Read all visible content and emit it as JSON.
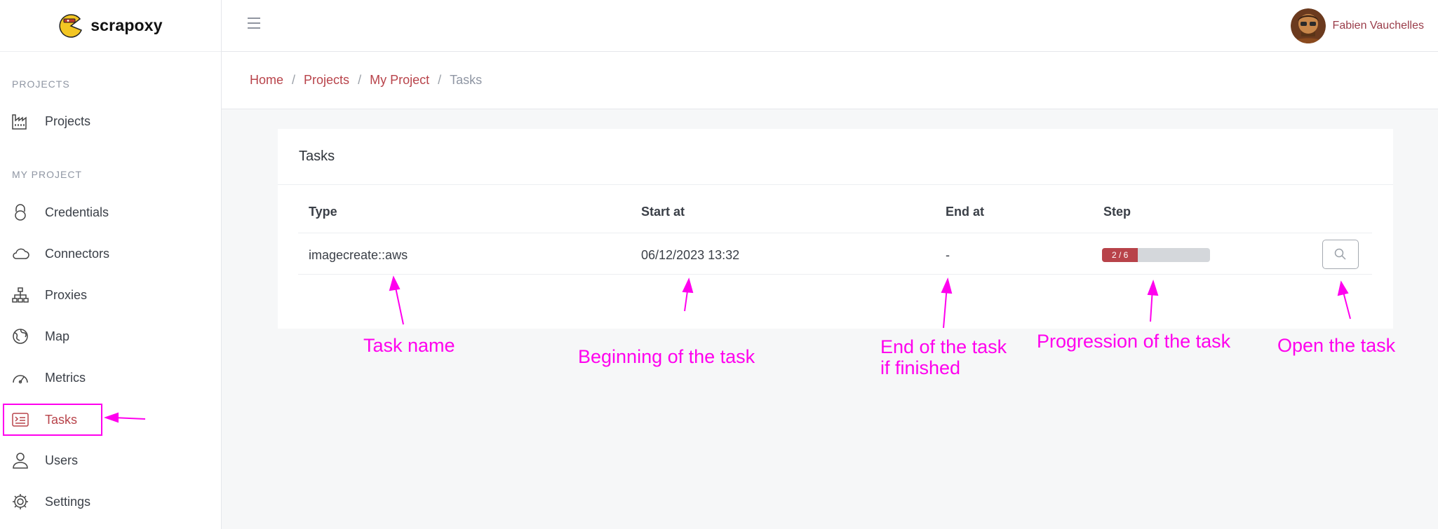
{
  "brand": {
    "name": "scrapoxy"
  },
  "user": {
    "name": "Fabien Vauchelles"
  },
  "sidebar": {
    "section_projects": "PROJECTS",
    "section_my_project": "MY PROJECT",
    "items": [
      {
        "label": "Projects",
        "icon": "factory-icon"
      },
      {
        "label": "Credentials",
        "icon": "lock-icon"
      },
      {
        "label": "Connectors",
        "icon": "cloud-icon"
      },
      {
        "label": "Proxies",
        "icon": "sitemap-icon"
      },
      {
        "label": "Map",
        "icon": "globe-icon"
      },
      {
        "label": "Metrics",
        "icon": "gauge-icon"
      },
      {
        "label": "Tasks",
        "icon": "terminal-icon",
        "active": true
      },
      {
        "label": "Users",
        "icon": "user-icon"
      },
      {
        "label": "Settings",
        "icon": "gear-icon"
      }
    ]
  },
  "breadcrumb": {
    "home": "Home",
    "projects": "Projects",
    "project": "My Project",
    "current": "Tasks",
    "separator": "/"
  },
  "card": {
    "title": "Tasks"
  },
  "table": {
    "columns": [
      "Type",
      "Start at",
      "End at",
      "Step"
    ],
    "rows": [
      {
        "type": "imagecreate::aws",
        "start_at": "06/12/2023 13:32",
        "end_at": "-",
        "step_label": "2 / 6",
        "step_current": 2,
        "step_total": 6
      }
    ]
  },
  "annotations": {
    "task_name": "Task name",
    "beginning": "Beginning of the task",
    "end_line1": "End of the task",
    "end_line2": "if finished",
    "progression": "Progression of the task",
    "open": "Open the task"
  },
  "colors": {
    "accent": "#b8434a",
    "annotation": "#ff00ee"
  }
}
